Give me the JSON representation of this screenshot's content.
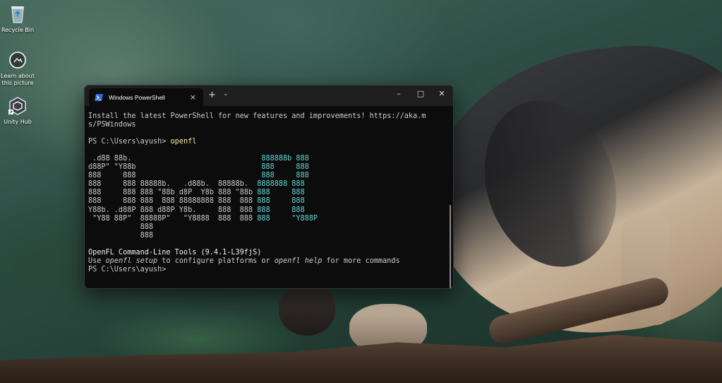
{
  "desktop": {
    "icons": [
      {
        "label": "Recycle Bin",
        "icon": "recycle-bin-icon"
      },
      {
        "label": "Learn about this picture",
        "icon": "camera-icon"
      },
      {
        "label": "Unity Hub",
        "icon": "unity-icon"
      }
    ]
  },
  "window": {
    "tab_title": "Windows PowerShell",
    "tab_close": "×",
    "new_tab": "+",
    "dropdown": "⌄",
    "minimize": "–",
    "maximize": "□",
    "close": "✕"
  },
  "terminal": {
    "install_line1": "Install the latest PowerShell for new features and improvements! https://aka.m",
    "install_line2": "s/PSWindows",
    "prompt1": "PS C:\\Users\\ayush> ",
    "command1": "openfl",
    "ascii_logo": [
      [
        " .d88 88b.                              ",
        "888888b 888"
      ],
      [
        "d88P\" \"Y88b                             ",
        "888     888"
      ],
      [
        "888     888                             ",
        "888     888"
      ],
      [
        "888     888 88888b.   .d88b.  88888b.  ",
        "8888888 888"
      ],
      [
        "888     888 888 \"88b d8P  Y8b 888 \"88b ",
        "888     888"
      ],
      [
        "888     888 888  888 88888888 888  888 ",
        "888     888"
      ],
      [
        "Y88b. .d88P 888 d88P Y8b.     888  888 ",
        "888     888"
      ],
      [
        " \"Y88 88P\"  88888P\"   \"Y8888  888  888 ",
        "888     \"Y888P"
      ],
      [
        "            888                        ",
        ""
      ],
      [
        "            888                        ",
        ""
      ]
    ],
    "version_line": "OpenFL Command-Line Tools (9.4.1-L39fjS)",
    "usage_prefix": "Use ",
    "usage_cmd1": "openfl setup",
    "usage_mid": " to configure platforms or ",
    "usage_cmd2": "openfl help",
    "usage_suffix": " for more commands",
    "prompt2": "PS C:\\Users\\ayush>"
  },
  "colors": {
    "terminal_bg": "#0c0c0c",
    "titlebar_bg": "#1e1e1e",
    "text": "#cccccc",
    "command": "#f9f1a5",
    "cyan": "#61d6d6"
  }
}
